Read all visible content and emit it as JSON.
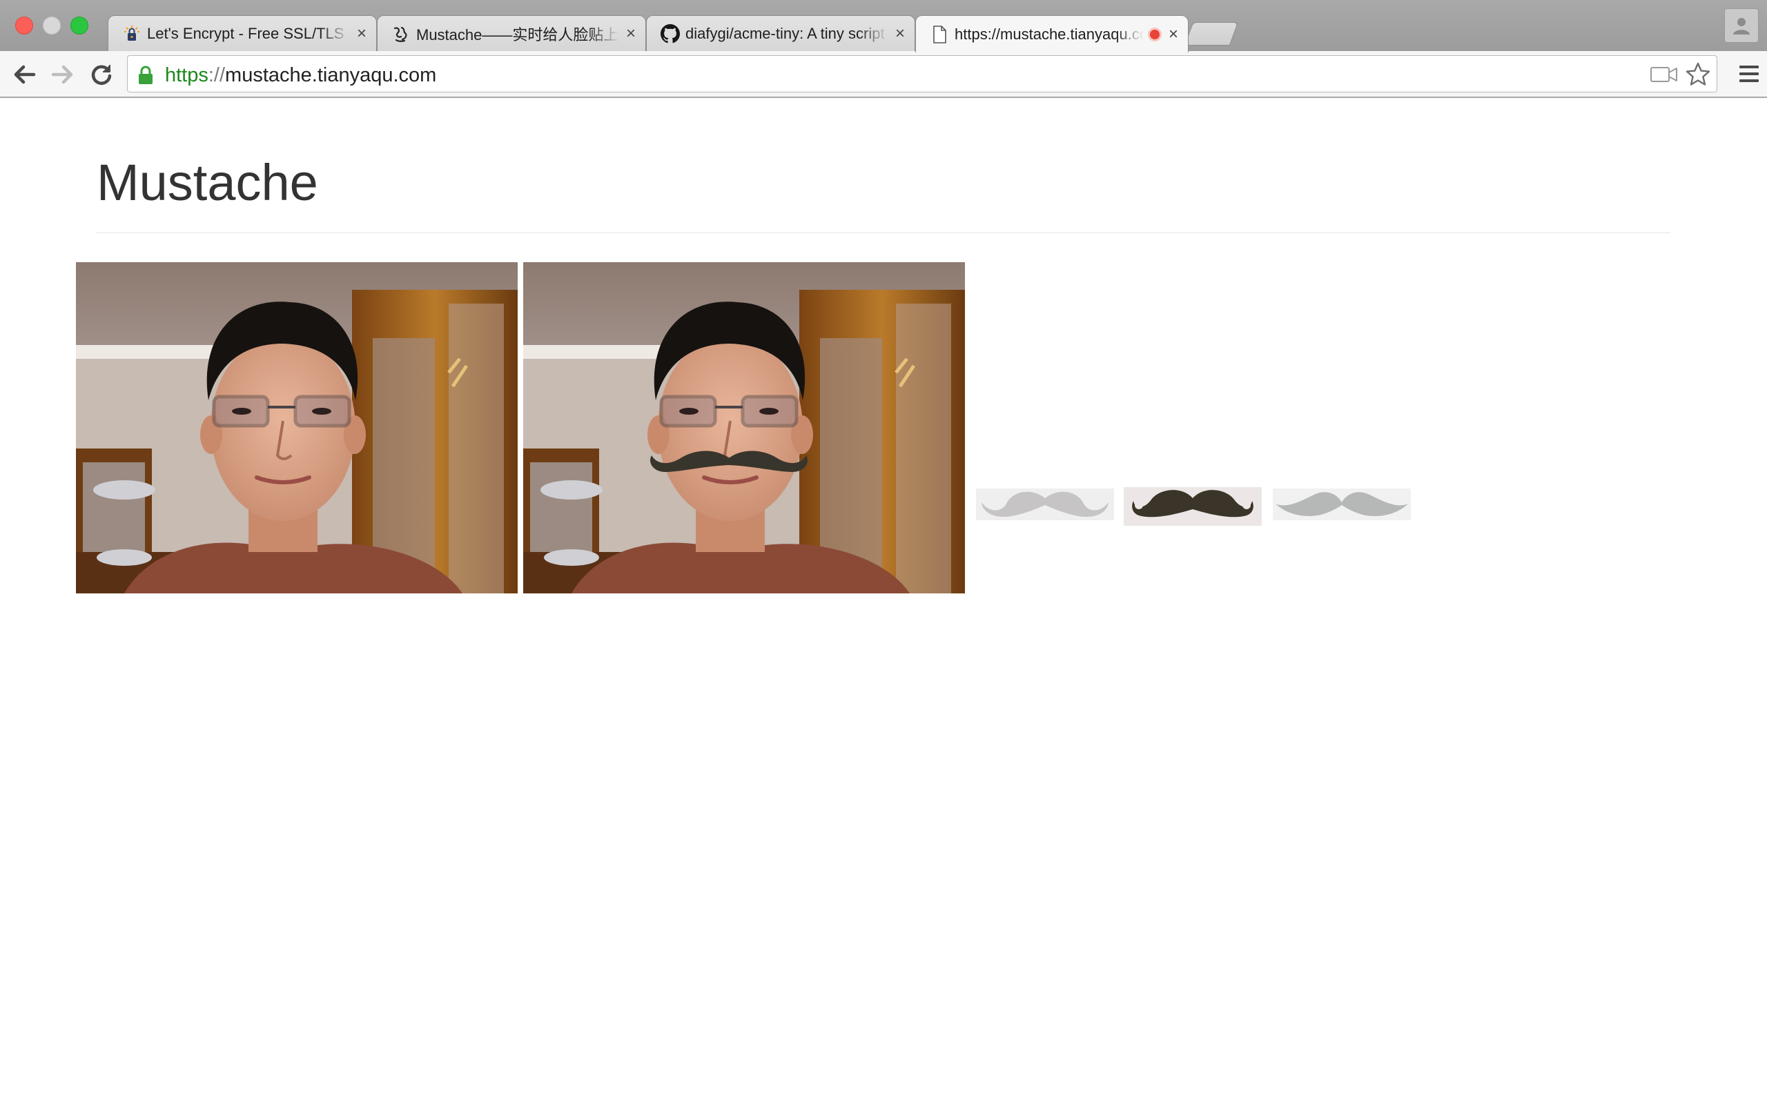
{
  "browser": {
    "tabs": [
      {
        "title": "Let's Encrypt - Free SSL/TLS Certificates",
        "favicon": "lets-encrypt-icon",
        "active": false
      },
      {
        "title": "Mustache——实时给人脸贴上胡子",
        "favicon": "app-logo-icon",
        "active": false
      },
      {
        "title": "diafygi/acme-tiny: A tiny script to issue and renew TLS certs",
        "favicon": "github-icon",
        "active": false
      },
      {
        "title": "https://mustache.tianyaqu.com",
        "favicon": "page-icon",
        "active": true,
        "recording": true
      }
    ],
    "close_glyph": "×",
    "address": {
      "scheme": "https",
      "separator": "://",
      "host": "mustache.tianyaqu.com"
    }
  },
  "page": {
    "heading": "Mustache",
    "photos": [
      {
        "name": "original-webcam-frame"
      },
      {
        "name": "webcam-frame-with-mustache"
      }
    ],
    "mustache_options": [
      {
        "style": "light-gray-curled",
        "selected": false
      },
      {
        "style": "dark-brown-curled",
        "selected": true
      },
      {
        "style": "gray-wavy",
        "selected": false
      }
    ]
  },
  "colors": {
    "tab_strip": "#a3a3a3",
    "secure_scheme": "#1b8a1b",
    "heading": "#333333",
    "record_dot": "#ea4335"
  }
}
